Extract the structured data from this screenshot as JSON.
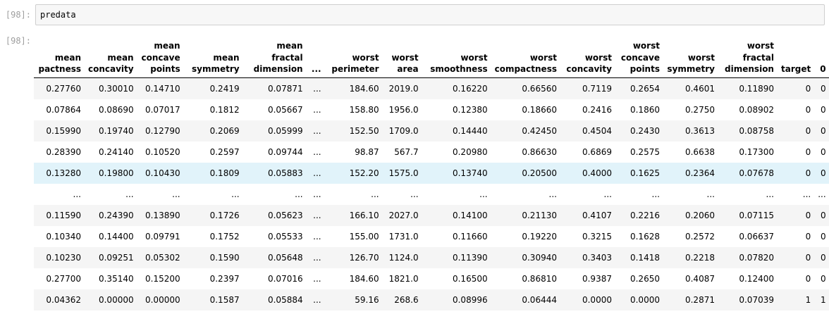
{
  "prompts": {
    "input": "[98]:",
    "output": "[98]:"
  },
  "input_code": "predata",
  "table": {
    "columns": [
      [
        "mean",
        "pactness"
      ],
      [
        "mean",
        "concavity"
      ],
      [
        "mean",
        "concave",
        "points"
      ],
      [
        "mean",
        "symmetry"
      ],
      [
        "mean",
        "fractal",
        "dimension"
      ],
      [
        "..."
      ],
      [
        "worst",
        "perimeter"
      ],
      [
        "worst",
        "area"
      ],
      [
        "worst",
        "smoothness"
      ],
      [
        "worst",
        "compactness"
      ],
      [
        "worst",
        "concavity"
      ],
      [
        "worst",
        "concave",
        "points"
      ],
      [
        "worst",
        "symmetry"
      ],
      [
        "worst",
        "fractal",
        "dimension"
      ],
      [
        "target"
      ],
      [
        "0"
      ]
    ],
    "rows": [
      [
        "0.27760",
        "0.30010",
        "0.14710",
        "0.2419",
        "0.07871",
        "...",
        "184.60",
        "2019.0",
        "0.16220",
        "0.66560",
        "0.7119",
        "0.2654",
        "0.4601",
        "0.11890",
        "0",
        "0"
      ],
      [
        "0.07864",
        "0.08690",
        "0.07017",
        "0.1812",
        "0.05667",
        "...",
        "158.80",
        "1956.0",
        "0.12380",
        "0.18660",
        "0.2416",
        "0.1860",
        "0.2750",
        "0.08902",
        "0",
        "0"
      ],
      [
        "0.15990",
        "0.19740",
        "0.12790",
        "0.2069",
        "0.05999",
        "...",
        "152.50",
        "1709.0",
        "0.14440",
        "0.42450",
        "0.4504",
        "0.2430",
        "0.3613",
        "0.08758",
        "0",
        "0"
      ],
      [
        "0.28390",
        "0.24140",
        "0.10520",
        "0.2597",
        "0.09744",
        "...",
        "98.87",
        "567.7",
        "0.20980",
        "0.86630",
        "0.6869",
        "0.2575",
        "0.6638",
        "0.17300",
        "0",
        "0"
      ],
      [
        "0.13280",
        "0.19800",
        "0.10430",
        "0.1809",
        "0.05883",
        "...",
        "152.20",
        "1575.0",
        "0.13740",
        "0.20500",
        "0.4000",
        "0.1625",
        "0.2364",
        "0.07678",
        "0",
        "0"
      ],
      [
        "...",
        "...",
        "...",
        "...",
        "...",
        "...",
        "...",
        "...",
        "...",
        "...",
        "...",
        "...",
        "...",
        "...",
        "...",
        "..."
      ],
      [
        "0.11590",
        "0.24390",
        "0.13890",
        "0.1726",
        "0.05623",
        "...",
        "166.10",
        "2027.0",
        "0.14100",
        "0.21130",
        "0.4107",
        "0.2216",
        "0.2060",
        "0.07115",
        "0",
        "0"
      ],
      [
        "0.10340",
        "0.14400",
        "0.09791",
        "0.1752",
        "0.05533",
        "...",
        "155.00",
        "1731.0",
        "0.11660",
        "0.19220",
        "0.3215",
        "0.1628",
        "0.2572",
        "0.06637",
        "0",
        "0"
      ],
      [
        "0.10230",
        "0.09251",
        "0.05302",
        "0.1590",
        "0.05648",
        "...",
        "126.70",
        "1124.0",
        "0.11390",
        "0.30940",
        "0.3403",
        "0.1418",
        "0.2218",
        "0.07820",
        "0",
        "0"
      ],
      [
        "0.27700",
        "0.35140",
        "0.15200",
        "0.2397",
        "0.07016",
        "...",
        "184.60",
        "1821.0",
        "0.16500",
        "0.86810",
        "0.9387",
        "0.2650",
        "0.4087",
        "0.12400",
        "0",
        "0"
      ],
      [
        "0.04362",
        "0.00000",
        "0.00000",
        "0.1587",
        "0.05884",
        "...",
        "59.16",
        "268.6",
        "0.08996",
        "0.06444",
        "0.0000",
        "0.0000",
        "0.2871",
        "0.07039",
        "1",
        "1"
      ]
    ],
    "highlighted_row": 4
  },
  "colors": {
    "highlight_row": "#e1f3fa",
    "stripe_row": "#f5f5f5",
    "prompt": "#9e9e9e"
  }
}
